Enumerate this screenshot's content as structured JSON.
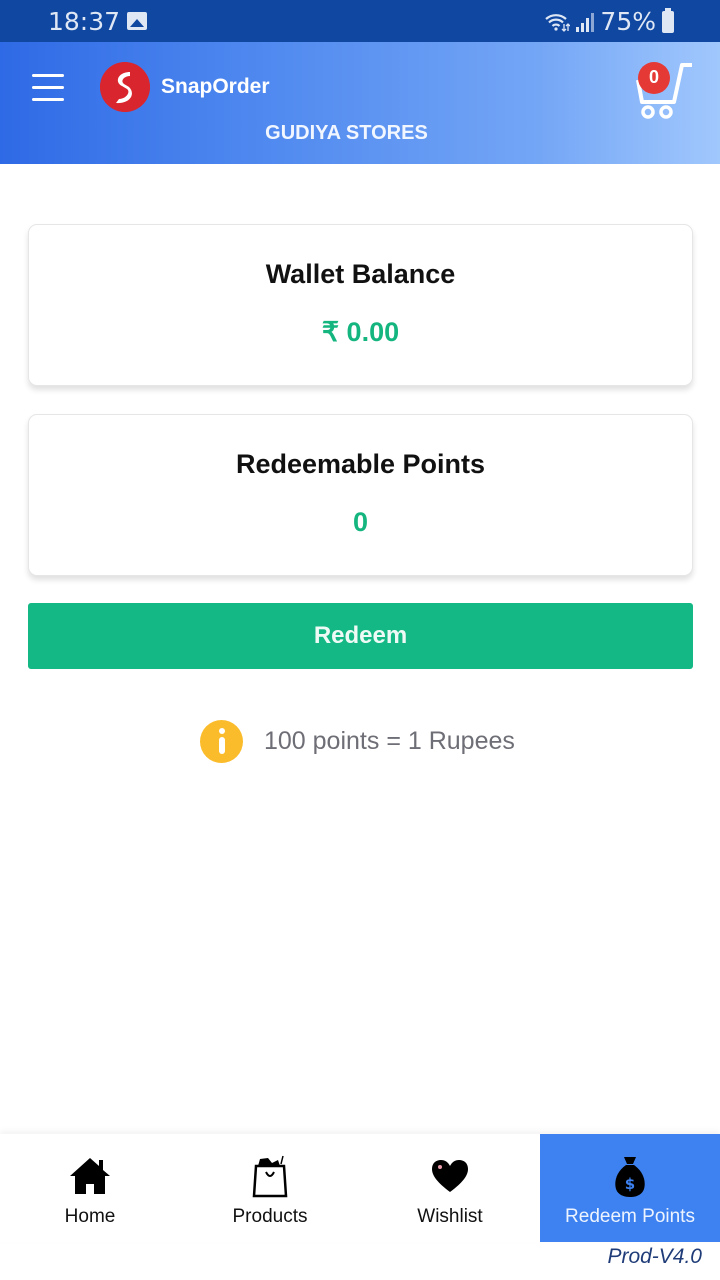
{
  "status_bar": {
    "time": "18:37",
    "battery": "75%"
  },
  "header": {
    "brand": "SnapOrder",
    "store_name": "GUDIYA STORES",
    "cart_count": "0"
  },
  "wallet": {
    "title": "Wallet Balance",
    "value": "₹ 0.00"
  },
  "points": {
    "title": "Redeemable Points",
    "value": "0"
  },
  "redeem_button": "Redeem",
  "info_text": "100 points = 1 Rupees",
  "bottom_nav": {
    "items": [
      {
        "label": "Home",
        "icon": "home-icon"
      },
      {
        "label": "Products",
        "icon": "shopping-bag-icon"
      },
      {
        "label": "Wishlist",
        "icon": "heart-icon"
      },
      {
        "label": "Redeem Points",
        "icon": "money-bag-icon",
        "active": true
      }
    ]
  },
  "version": "Prod-V4.0",
  "colors": {
    "accent_green": "#14b884",
    "nav_active": "#3d82f0",
    "badge_red": "#e53935",
    "info_yellow": "#fbbc2c"
  }
}
